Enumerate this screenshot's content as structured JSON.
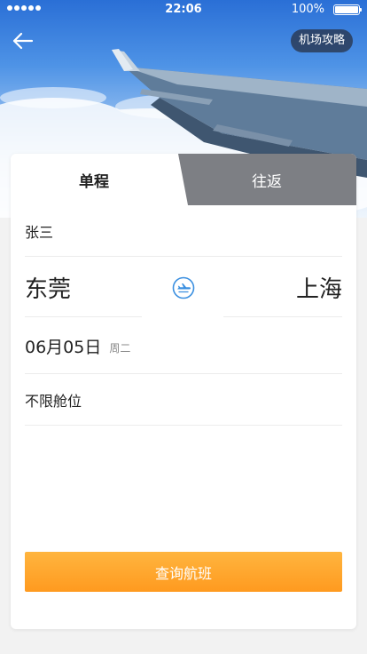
{
  "status_bar": {
    "time": "22:06",
    "battery_percent": "100%"
  },
  "header": {
    "guide_button": "机场攻略"
  },
  "tabs": [
    {
      "label": "单程",
      "active": true
    },
    {
      "label": "往返",
      "active": false
    }
  ],
  "form": {
    "passenger": "张三",
    "from_city": "东莞",
    "to_city": "上海",
    "date": "06月05日",
    "weekday": "周二",
    "cabin_class": "不限舱位"
  },
  "search_button": "查询航班",
  "colors": {
    "accent_orange": "#ff9a1f",
    "swap_icon_blue": "#3a8fe0",
    "inactive_tab": "#7d7f84"
  },
  "icons": {
    "back": "arrow-left-icon",
    "swap": "airplane-swap-icon"
  }
}
